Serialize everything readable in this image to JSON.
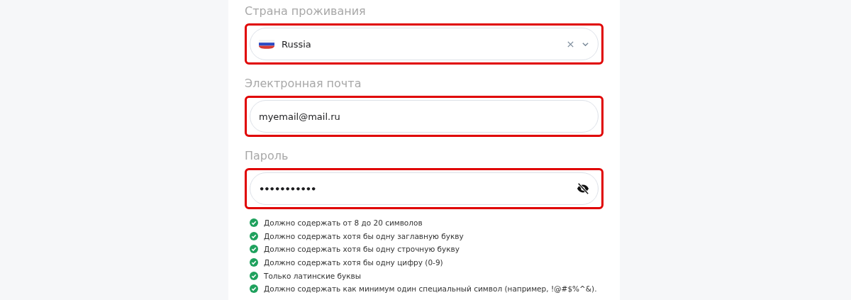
{
  "fields": [
    {
      "kind": "country",
      "label": "Страна проживания",
      "value": "Russia",
      "highlighted": true
    },
    {
      "kind": "email",
      "label": "Электронная почта",
      "value": "myemail@mail.ru",
      "highlighted": true
    },
    {
      "kind": "password",
      "label": "Пароль",
      "value": "•••••••••••",
      "highlighted": true
    }
  ],
  "requirements": [
    {
      "text": "Должно содержать от 8 до 20 символов",
      "met": true
    },
    {
      "text": "Должно содержать хотя бы одну заглавную букву",
      "met": true
    },
    {
      "text": "Должно содержать хотя бы одну строчную букву",
      "met": true
    },
    {
      "text": "Должно содержать хотя бы одну цифру (0-9)",
      "met": true
    },
    {
      "text": "Только латинские буквы",
      "met": true
    },
    {
      "text": "Должно содержать как минимум один специальный символ (например, !@#$%^&).",
      "met": true
    }
  ]
}
